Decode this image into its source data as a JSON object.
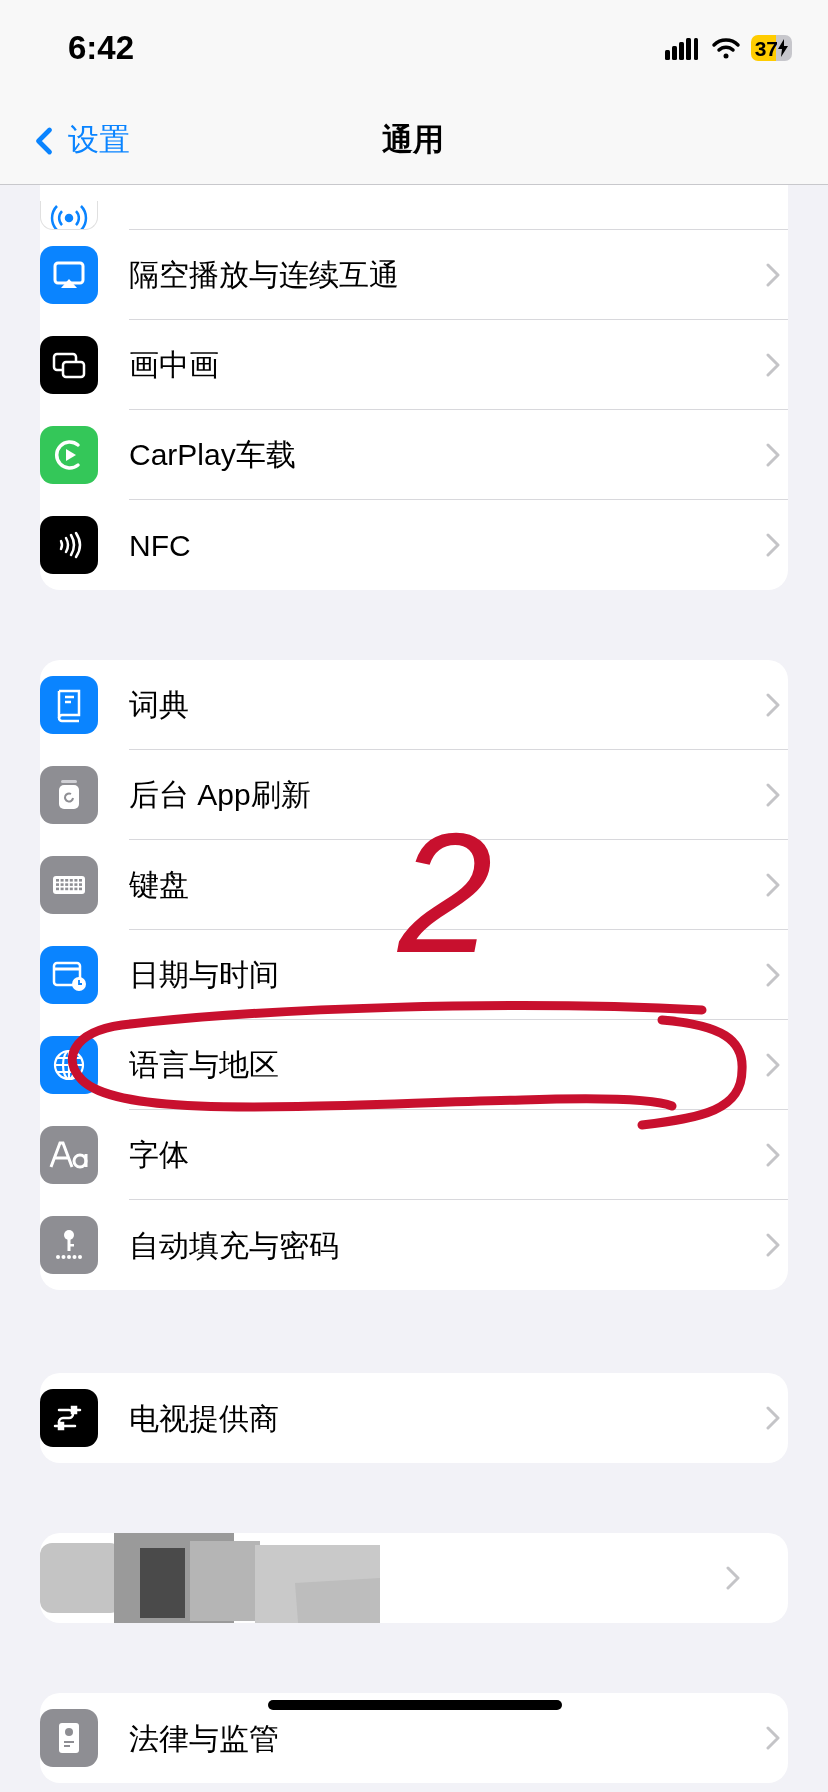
{
  "status_bar": {
    "time": "6:42",
    "battery": "37",
    "low_power": true
  },
  "nav": {
    "back": "设置",
    "title": "通用"
  },
  "groups": [
    {
      "items": [
        {
          "kind": "cut"
        },
        {
          "kind": "row",
          "label": "隔空播放与连续互通"
        },
        {
          "kind": "row",
          "label": "画中画"
        },
        {
          "kind": "row",
          "label": "CarPlay车载"
        },
        {
          "kind": "row",
          "label": "NFC"
        }
      ]
    },
    {
      "items": [
        {
          "kind": "row",
          "label": "词典"
        },
        {
          "kind": "row",
          "label": "后台 App刷新"
        },
        {
          "kind": "row",
          "label": "键盘"
        },
        {
          "kind": "row",
          "label": "日期与时间"
        },
        {
          "kind": "row",
          "label": "语言与地区"
        },
        {
          "kind": "row",
          "label": "字体"
        },
        {
          "kind": "row",
          "label": "自动填充与密码"
        }
      ]
    },
    {
      "items": [
        {
          "kind": "row",
          "label": "电视提供商"
        }
      ]
    },
    {
      "items": [
        {
          "kind": "redacted"
        }
      ]
    },
    {
      "items": [
        {
          "kind": "row",
          "label": "法律与监管"
        }
      ]
    }
  ],
  "annotation": {
    "number": "2"
  }
}
